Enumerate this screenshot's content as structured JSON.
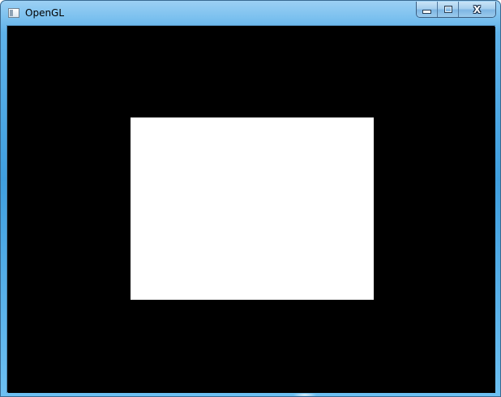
{
  "window": {
    "title": "OpenGL",
    "app_icon": "application-window-icon",
    "controls": {
      "minimize_icon": "minimize-icon",
      "maximize_icon": "maximize-icon",
      "close_icon": "close-icon",
      "close_label": "X"
    }
  },
  "canvas": {
    "background_color": "#000000",
    "shape": {
      "kind": "rectangle",
      "color": "#ffffff"
    }
  }
}
